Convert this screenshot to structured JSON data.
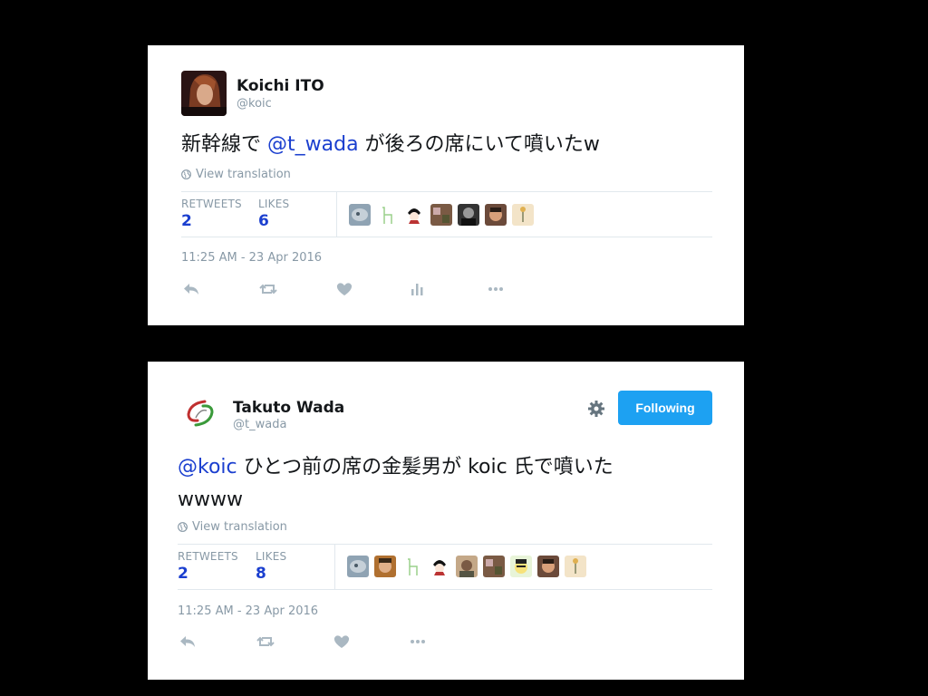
{
  "tweets": [
    {
      "name": "Koichi ITO",
      "handle": "@koic",
      "body_before": "新幹線で ",
      "mention": "@t_wada",
      "body_after": " が後ろの席にいて噴いたw",
      "view_translation": "View translation",
      "retweets_label": "RETWEETS",
      "retweets": "2",
      "likes_label": "LIKES",
      "likes": "6",
      "timestamp": "11:25 AM - 23 Apr 2016"
    },
    {
      "name": "Takuto Wada",
      "handle": "@t_wada",
      "mention": "@koic",
      "body_line1": " ひとつ前の席の金髪男が koic 氏で噴いた",
      "body_line2": "wwww",
      "view_translation": "View translation",
      "retweets_label": "RETWEETS",
      "retweets": "2",
      "likes_label": "LIKES",
      "likes": "8",
      "timestamp": "11:25 AM - 23 Apr 2016",
      "follow_label": "Following"
    }
  ],
  "colors": {
    "mention": "#1b3fcf",
    "follow_button": "#1da1f2",
    "muted": "#8899a6"
  },
  "icons": [
    "globe-icon",
    "reply-icon",
    "retweet-icon",
    "like-icon",
    "analytics-icon",
    "more-icon",
    "gear-icon"
  ]
}
